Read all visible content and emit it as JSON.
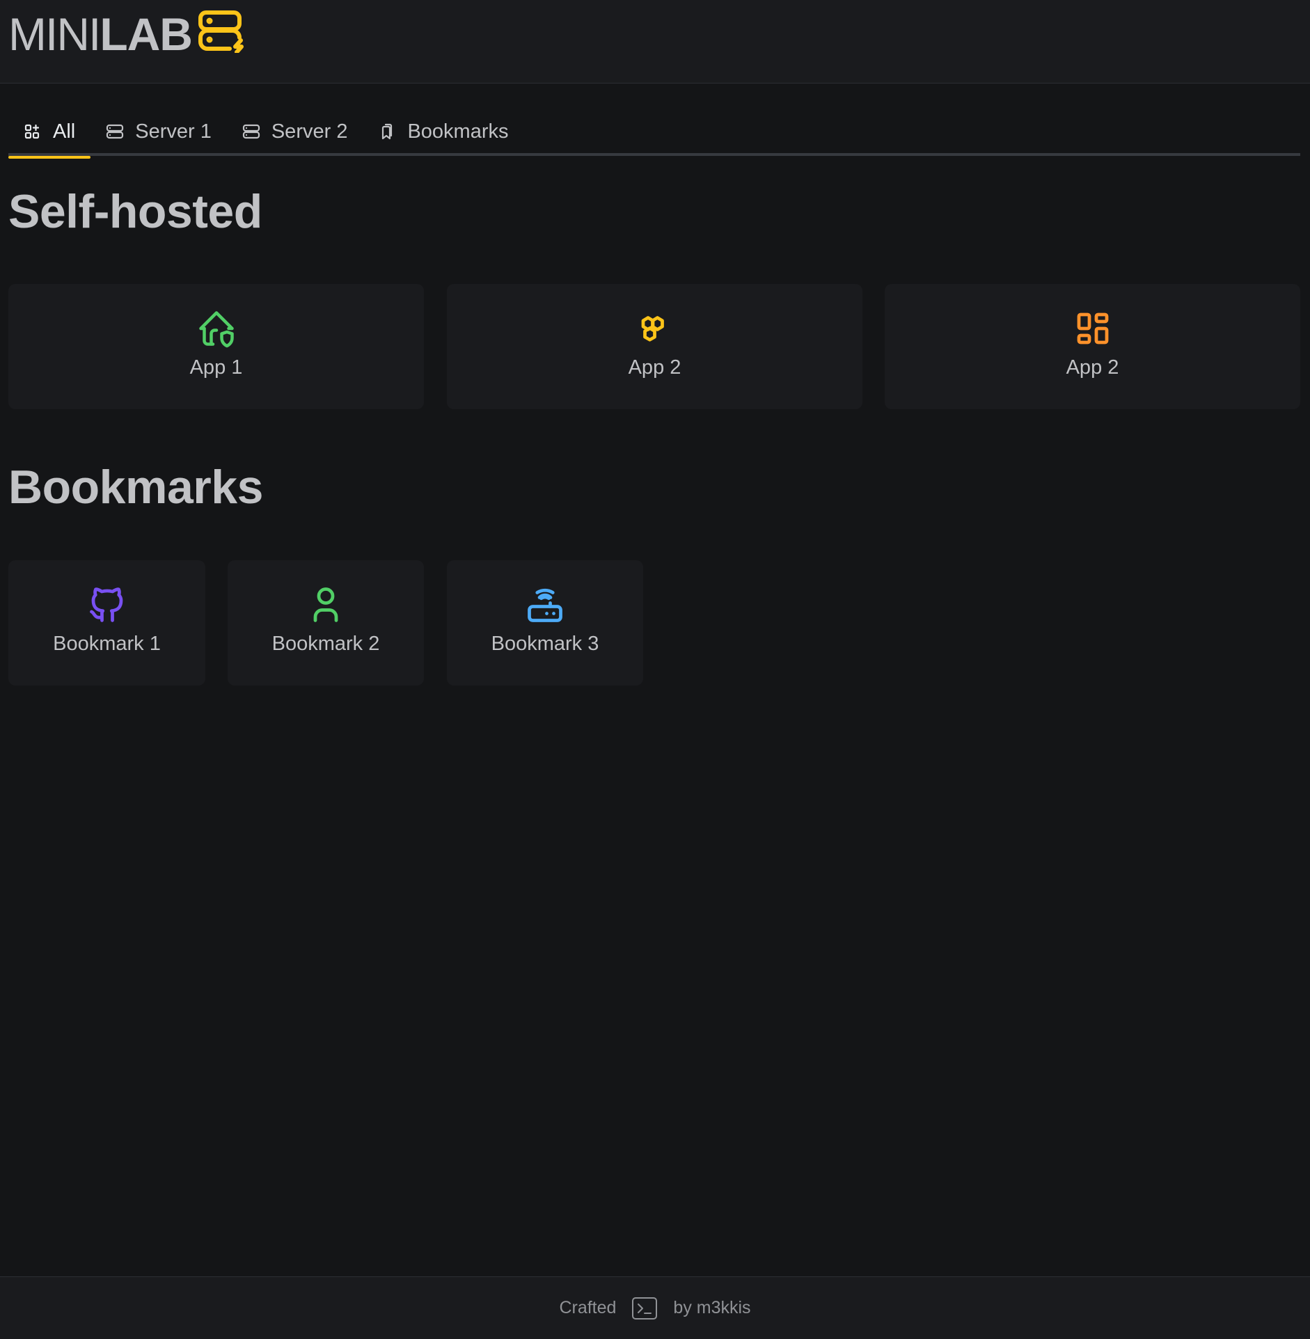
{
  "logo": {
    "part1": "MINI",
    "part2": "LAB",
    "icon": "server-bolt-icon",
    "icon_color": "#fcc419"
  },
  "tabs": [
    {
      "label": "All",
      "icon": "apps-icon",
      "active": true
    },
    {
      "label": "Server 1",
      "icon": "server-icon",
      "active": false
    },
    {
      "label": "Server 2",
      "icon": "server-icon",
      "active": false
    },
    {
      "label": "Bookmarks",
      "icon": "bookmarks-icon",
      "active": false
    }
  ],
  "accent_color": "#fcc419",
  "sections": {
    "selfhosted": {
      "title": "Self-hosted",
      "apps": [
        {
          "label": "App 1",
          "icon": "home-shield-icon",
          "color": "#51cf66"
        },
        {
          "label": "App 2",
          "icon": "hexagons-icon",
          "color": "#fcc419"
        },
        {
          "label": "App 2",
          "icon": "layout-dashboard-icon",
          "color": "#ff922b"
        }
      ]
    },
    "bookmarks": {
      "title": "Bookmarks",
      "items": [
        {
          "label": "Bookmark 1",
          "icon": "github-icon",
          "color": "#7950f2"
        },
        {
          "label": "Bookmark 2",
          "icon": "user-icon",
          "color": "#51cf66"
        },
        {
          "label": "Bookmark 3",
          "icon": "router-icon",
          "color": "#4dabf7"
        }
      ]
    }
  },
  "footer": {
    "crafted": "Crafted",
    "by": "by m3kkis",
    "icon": "terminal-icon"
  }
}
